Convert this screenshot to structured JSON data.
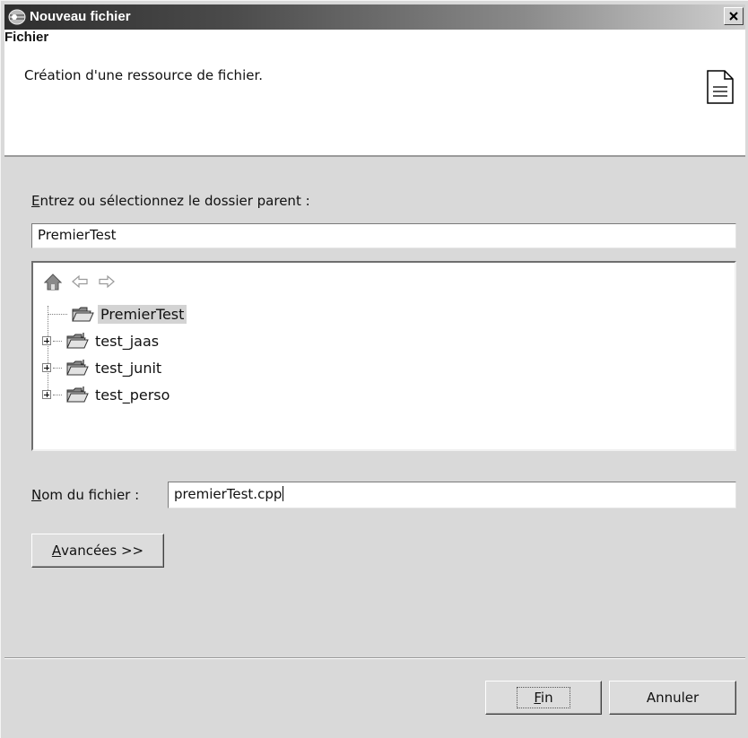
{
  "window": {
    "title": "Nouveau fichier",
    "icons": {
      "app": "eclipse-app-icon",
      "close": "close-icon"
    }
  },
  "banner": {
    "title": "Fichier",
    "description": "Création d'une ressource de fichier.",
    "icon": "document-icon"
  },
  "parent_folder": {
    "label_accesskey": "E",
    "label_rest": "ntrez ou sélectionnez le dossier parent :",
    "value": "PremierTest"
  },
  "tree": {
    "toolbar_icons": [
      "home-icon",
      "back-arrow-icon",
      "forward-arrow-icon"
    ],
    "items": [
      {
        "label": "PremierTest",
        "selected": true,
        "expandable": false,
        "icon": "open-folder-icon"
      },
      {
        "label": "test_jaas",
        "selected": false,
        "expandable": true,
        "icon": "project-folder-icon"
      },
      {
        "label": "test_junit",
        "selected": false,
        "expandable": true,
        "icon": "project-folder-icon"
      },
      {
        "label": "test_perso",
        "selected": false,
        "expandable": true,
        "icon": "project-folder-icon"
      }
    ]
  },
  "file_name": {
    "label_accesskey": "N",
    "label_rest": "om du fichier :",
    "value": "premierTest.cpp"
  },
  "buttons": {
    "advanced_accesskey": "A",
    "advanced_rest": "vancées >>",
    "finish_accesskey": "F",
    "finish_rest": "in",
    "cancel": "Annuler"
  },
  "colors": {
    "dialog_bg": "#d9d9d9",
    "selection_bg": "#d3d3d3"
  }
}
